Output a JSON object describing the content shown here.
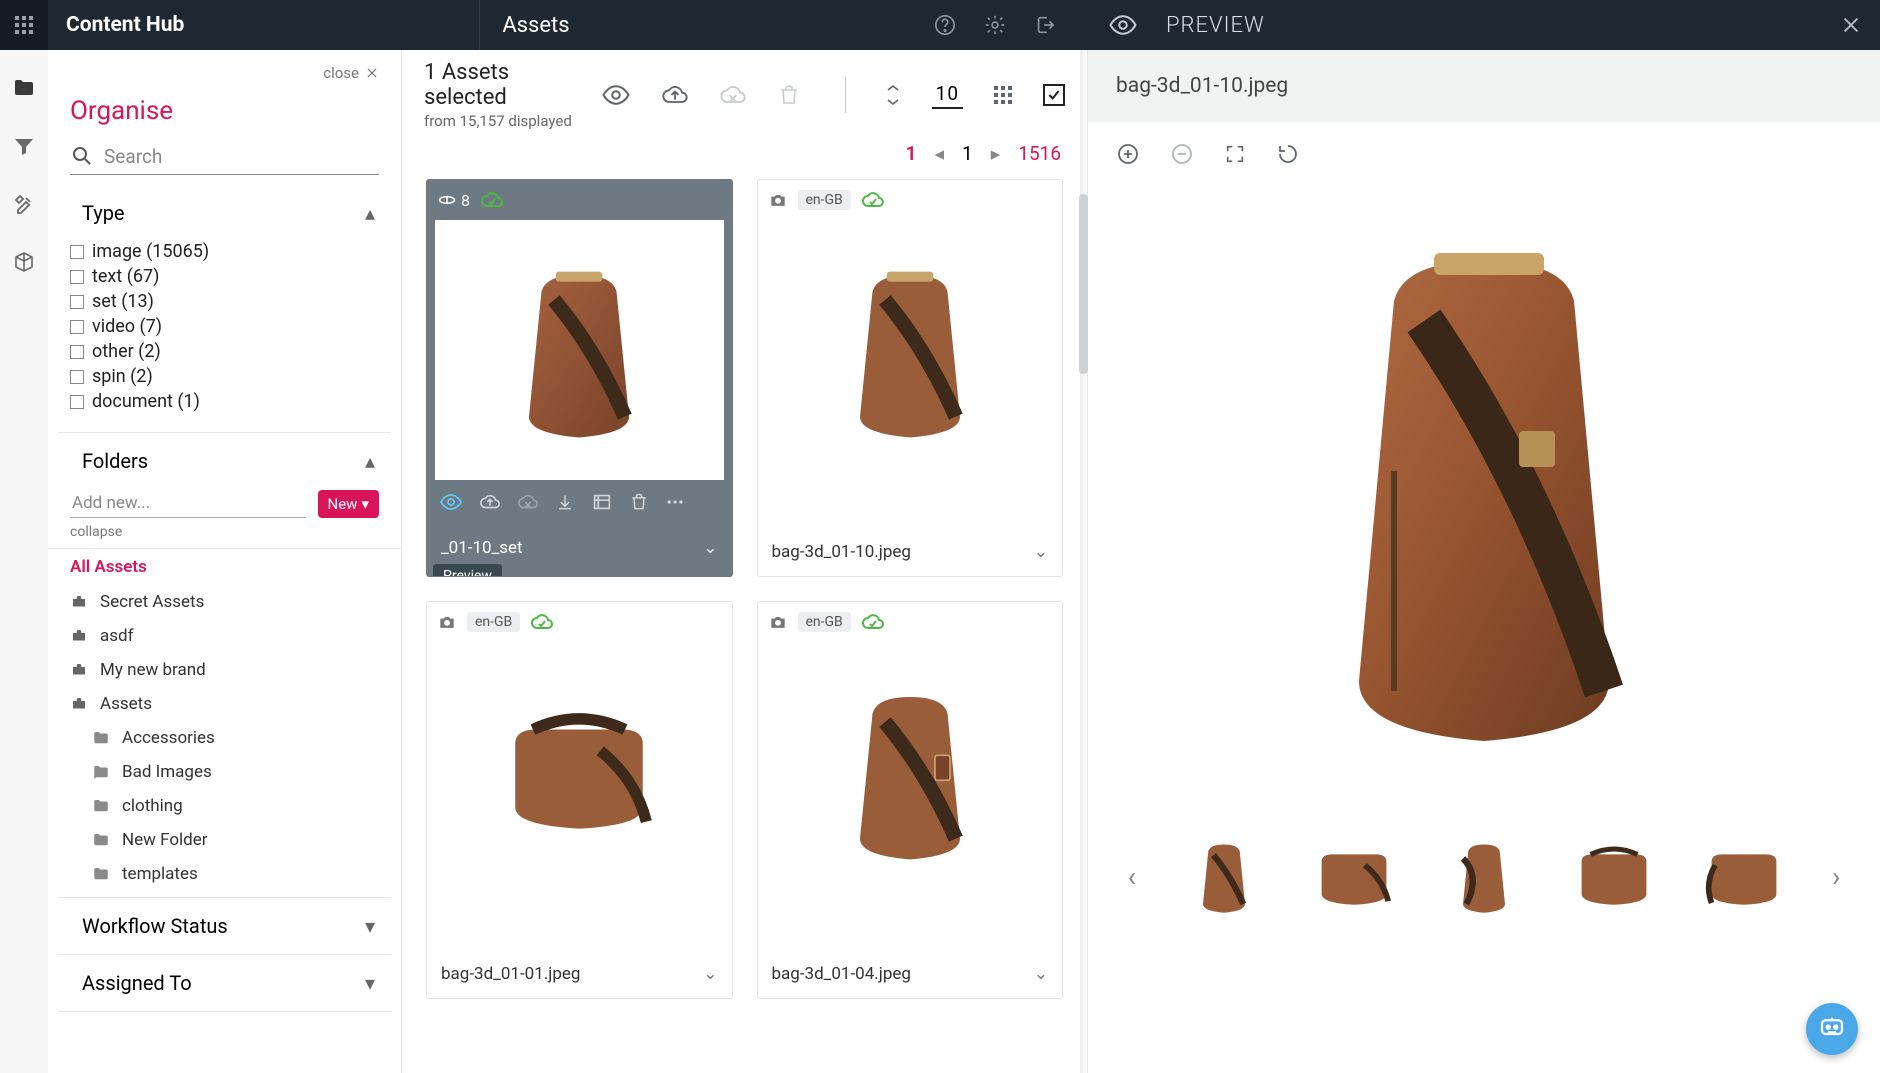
{
  "header": {
    "brand": "Content Hub",
    "section": "Assets",
    "previewTitle": "PREVIEW"
  },
  "organise": {
    "closeLabel": "close",
    "title": "Organise",
    "searchPlaceholder": "Search",
    "typeHeader": "Type",
    "types": [
      "image (15065)",
      "text (67)",
      "set (13)",
      "video (7)",
      "other (2)",
      "spin (2)",
      "document (1)"
    ],
    "foldersHeader": "Folders",
    "addNewPlaceholder": "Add new...",
    "newBtn": "New",
    "collapse": "collapse",
    "allAssets": "All Assets",
    "folders": [
      "Secret Assets",
      "asdf",
      "My new brand",
      "Assets"
    ],
    "subfolders": [
      "Accessories",
      "Bad Images",
      "clothing",
      "New Folder",
      "templates"
    ],
    "workflow": "Workflow Status",
    "assignedTo": "Assigned To"
  },
  "assets": {
    "selectedLine": "1 Assets selected",
    "displayedLine": "from 15,157 displayed",
    "pageSize": "10",
    "pager": {
      "current": "1",
      "page": "1",
      "total": "1516"
    },
    "tooltip": "Preview",
    "cards": [
      {
        "name": "_01-10_set",
        "selected": true,
        "type": "spin",
        "spinCount": "8",
        "locale": ""
      },
      {
        "name": "bag-3d_01-10.jpeg",
        "selected": false,
        "type": "image",
        "locale": "en-GB"
      },
      {
        "name": "bag-3d_01-01.jpeg",
        "selected": false,
        "type": "image",
        "locale": "en-GB"
      },
      {
        "name": "bag-3d_01-04.jpeg",
        "selected": false,
        "type": "image",
        "locale": "en-GB"
      }
    ]
  },
  "preview": {
    "filename": "bag-3d_01-10.jpeg"
  }
}
